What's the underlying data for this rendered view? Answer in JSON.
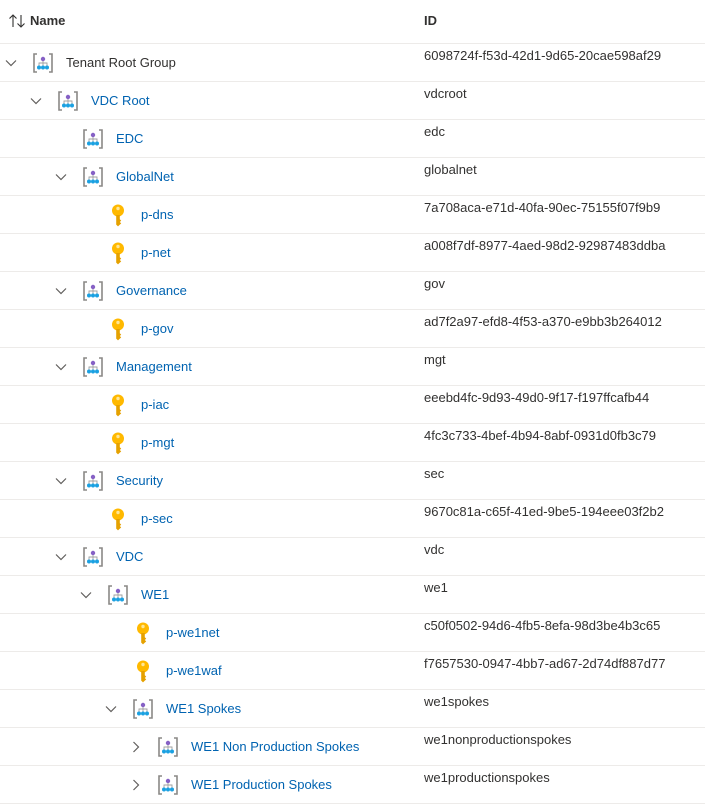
{
  "header": {
    "name_label": "Name",
    "id_label": "ID"
  },
  "rows": [
    {
      "name": "Tenant Root Group",
      "id": "6098724f-f53d-42d1-9d65-20cae598af29",
      "type": "group-icon"
    },
    {
      "name": "VDC Root",
      "id": "vdcroot",
      "type": "group-icon"
    },
    {
      "name": "EDC",
      "id": "edc",
      "type": "group-icon"
    },
    {
      "name": "GlobalNet",
      "id": "globalnet",
      "type": "group-icon"
    },
    {
      "name": "p-dns",
      "id": "7a708aca-e71d-40fa-90ec-75155f07f9b9",
      "type": "key-icon"
    },
    {
      "name": "p-net",
      "id": "a008f7df-8977-4aed-98d2-92987483ddba",
      "type": "key-icon"
    },
    {
      "name": "Governance",
      "id": "gov",
      "type": "group-icon"
    },
    {
      "name": "p-gov",
      "id": "ad7f2a97-efd8-4f53-a370-e9bb3b264012",
      "type": "key-icon"
    },
    {
      "name": "Management",
      "id": "mgt",
      "type": "group-icon"
    },
    {
      "name": "p-iac",
      "id": "eeebd4fc-9d93-49d0-9f17-f197ffcafb44",
      "type": "key-icon"
    },
    {
      "name": "p-mgt",
      "id": "4fc3c733-4bef-4b94-8abf-0931d0fb3c79",
      "type": "key-icon"
    },
    {
      "name": "Security",
      "id": "sec",
      "type": "group-icon"
    },
    {
      "name": "p-sec",
      "id": "9670c81a-c65f-41ed-9be5-194eee03f2b2",
      "type": "key-icon"
    },
    {
      "name": "VDC",
      "id": "vdc",
      "type": "group-icon"
    },
    {
      "name": "WE1",
      "id": "we1",
      "type": "group-icon"
    },
    {
      "name": "p-we1net",
      "id": "c50f0502-94d6-4fb5-8efa-98d3be4b3c65",
      "type": "key-icon"
    },
    {
      "name": "p-we1waf",
      "id": "f7657530-0947-4bb7-ad67-2d74df887d77",
      "type": "key-icon"
    },
    {
      "name": "WE1 Spokes",
      "id": "we1spokes",
      "type": "group-icon"
    },
    {
      "name": "WE1 Non Production Spokes",
      "id": "we1nonproductionspokes",
      "type": "group-icon"
    },
    {
      "name": "WE1 Production Spokes",
      "id": "we1productionspokes",
      "type": "group-icon"
    }
  ],
  "colors": {
    "link": "#0063b1",
    "text": "#323130",
    "border": "#edebe9",
    "key": "#ffb900",
    "group": "#8661c5"
  }
}
